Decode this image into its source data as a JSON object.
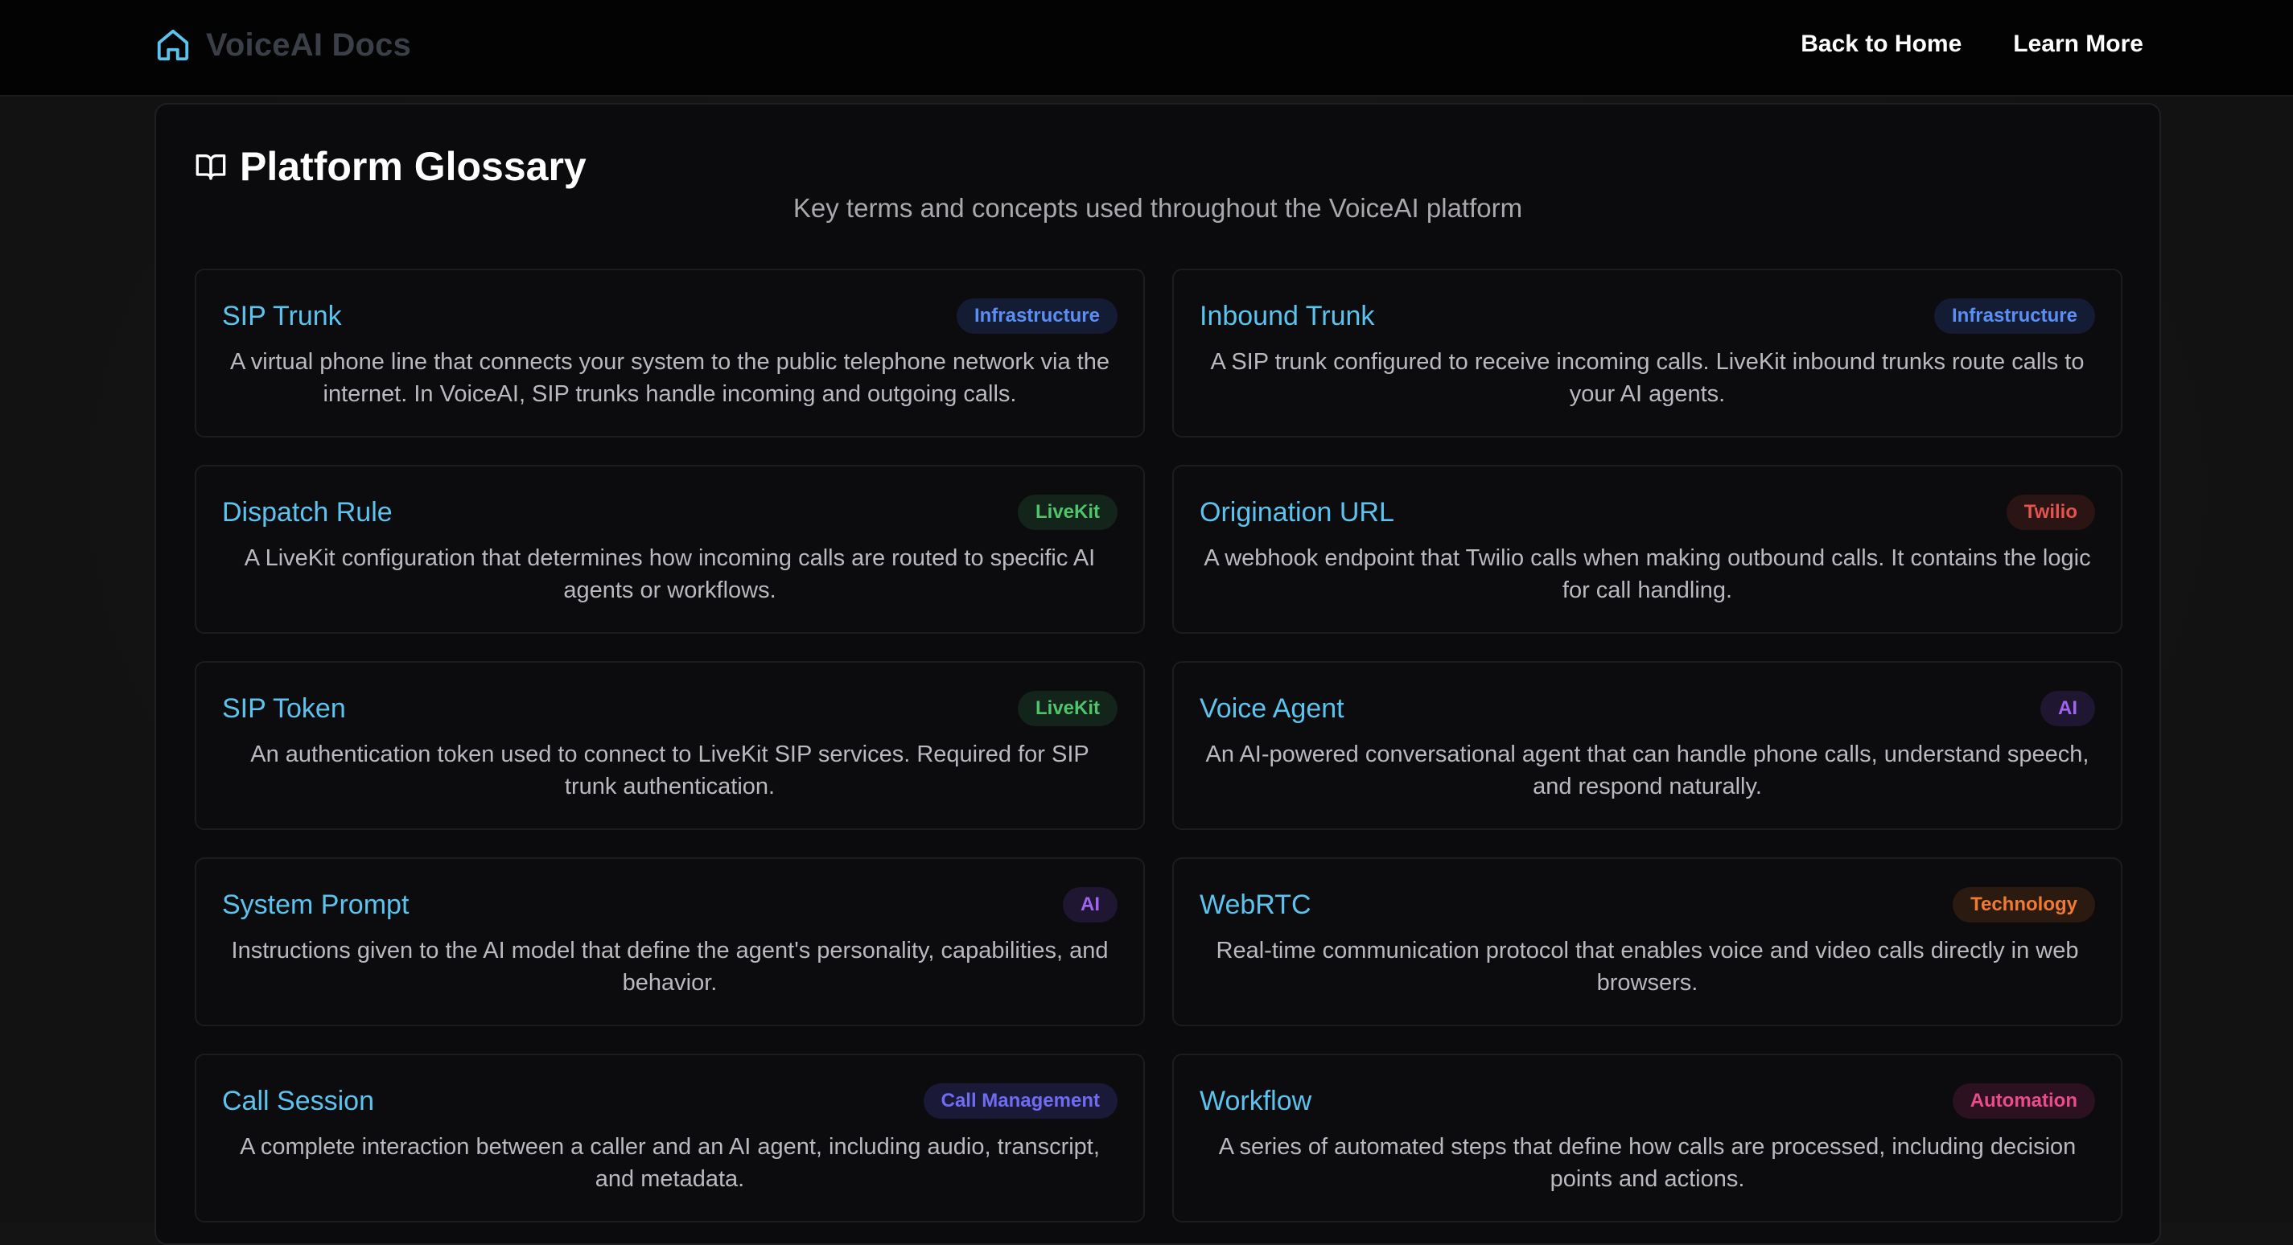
{
  "navbar": {
    "brand": "VoiceAI Docs",
    "brand_icon": "home-icon",
    "links": [
      {
        "label": "Back to Home"
      },
      {
        "label": "Learn More"
      }
    ]
  },
  "glossary": {
    "icon": "book-open-icon",
    "title": "Platform Glossary",
    "subtitle": "Key terms and concepts used throughout the VoiceAI platform",
    "terms": [
      {
        "term": "SIP Trunk",
        "category": "Infrastructure",
        "description": "A virtual phone line that connects your system to the public telephone network via the internet. In VoiceAI, SIP trunks handle incoming and outgoing calls."
      },
      {
        "term": "Inbound Trunk",
        "category": "Infrastructure",
        "description": "A SIP trunk configured to receive incoming calls. LiveKit inbound trunks route calls to your AI agents."
      },
      {
        "term": "Dispatch Rule",
        "category": "LiveKit",
        "description": "A LiveKit configuration that determines how incoming calls are routed to specific AI agents or workflows."
      },
      {
        "term": "Origination URL",
        "category": "Twilio",
        "description": "A webhook endpoint that Twilio calls when making outbound calls. It contains the logic for call handling."
      },
      {
        "term": "SIP Token",
        "category": "LiveKit",
        "description": "An authentication token used to connect to LiveKit SIP services. Required for SIP trunk authentication."
      },
      {
        "term": "Voice Agent",
        "category": "AI",
        "description": "An AI-powered conversational agent that can handle phone calls, understand speech, and respond naturally."
      },
      {
        "term": "System Prompt",
        "category": "AI",
        "description": "Instructions given to the AI model that define the agent's personality, capabilities, and behavior."
      },
      {
        "term": "WebRTC",
        "category": "Technology",
        "description": "Real-time communication protocol that enables voice and video calls directly in web browsers."
      },
      {
        "term": "Call Session",
        "category": "Call Management",
        "description": "A complete interaction between a caller and an AI agent, including audio, transcript, and metadata."
      },
      {
        "term": "Workflow",
        "category": "Automation",
        "description": "A series of automated steps that define how calls are processed, including decision points and actions."
      }
    ]
  },
  "badge_colors": {
    "Infrastructure": {
      "text": "#5b8ef5",
      "bg": "#141c33"
    },
    "LiveKit": {
      "text": "#4fc46a",
      "bg": "#13241a"
    },
    "Twilio": {
      "text": "#e4544f",
      "bg": "#2a1414"
    },
    "AI": {
      "text": "#a064f0",
      "bg": "#1f1631"
    },
    "Technology": {
      "text": "#f07a32",
      "bg": "#2b1a10"
    },
    "Call Management": {
      "text": "#6f6bf2",
      "bg": "#1a1a38"
    },
    "Automation": {
      "text": "#ea4c8a",
      "bg": "#2c1221"
    }
  }
}
